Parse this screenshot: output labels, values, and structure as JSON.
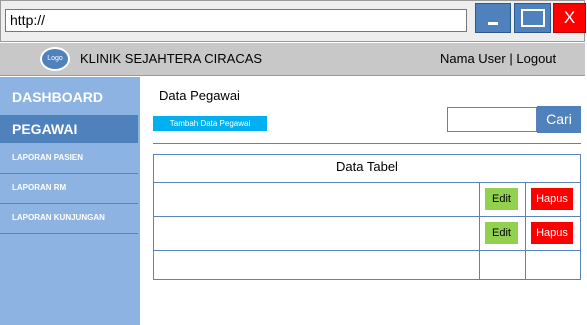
{
  "browser": {
    "address": "http://",
    "close_label": "X"
  },
  "header": {
    "logo_text": "Logo",
    "clinic_name": "KLINIK SEJAHTERA CIRACAS",
    "user_name": "Nama User",
    "separator": "|",
    "logout_label": "Logout"
  },
  "sidebar": {
    "items": [
      {
        "label": "DASHBOARD"
      },
      {
        "label": "PEGAWAI"
      },
      {
        "label": "LAPORAN PASIEN"
      },
      {
        "label": "LAPORAN RM"
      },
      {
        "label": "LAPORAN KUNJUNGAN"
      }
    ],
    "active_index": 1
  },
  "main": {
    "title": "Data Pegawai",
    "add_button": "Tambah Data Pegawai",
    "search_placeholder": "",
    "search_button": "Cari"
  },
  "table": {
    "header": "Data Tabel",
    "rows": [
      {
        "edit": "Edit",
        "delete": "Hapus"
      },
      {
        "edit": "Edit",
        "delete": "Hapus"
      },
      {
        "edit": "",
        "delete": ""
      }
    ]
  },
  "colors": {
    "accent": "#4f81bd",
    "sidebar": "#8db3e2",
    "add_button": "#00b0f0",
    "edit": "#92d050",
    "delete": "#ff0000"
  }
}
